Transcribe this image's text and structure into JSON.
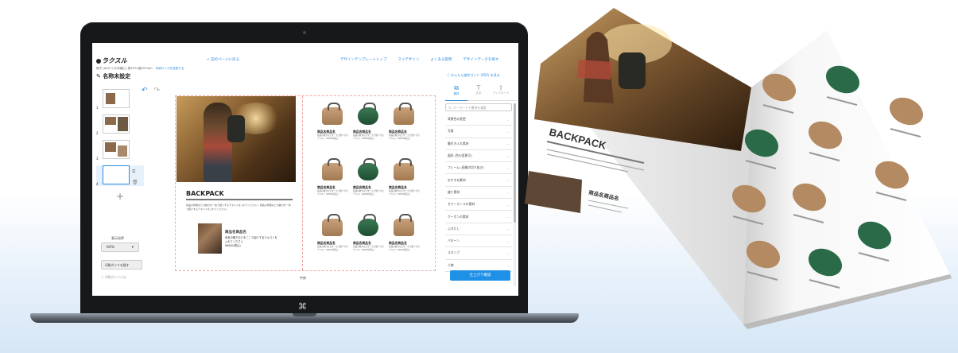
{
  "editor": {
    "logo": "ラクスル",
    "nav_back": "< 前のページに戻る",
    "nav_links": [
      "デザインテンプレートトップ",
      "マイデザイン",
      "よくある質問",
      "デザインデータを探す"
    ],
    "product_info": "冊子 (A4サイズ/中綴じ) 表207×縦297mm",
    "product_info_link": "印刷サイズを変更する",
    "doc_title": "名称未設定",
    "guide_link": "かんたん操作ガイド (PDF) を見る",
    "page_numbers": [
      "1",
      "2",
      "3",
      "4"
    ],
    "add_page": "+",
    "zoom_label": "表示倍率",
    "zoom_value": "60%",
    "guide_button": "印刷ガイドを隠す",
    "help_link": "印刷ガイドとは",
    "page_center_label": "中央"
  },
  "spread": {
    "title": "BACKPACK",
    "description": "商品の特徴などの魅力を一言で紹介するテキストを入れてください。商品の特徴などの魅力を一言で紹介するテキストを入れてください。",
    "lower_product_name": "商品名商品名",
    "lower_product_desc": [
      "商品の魅力などをここで紹介するテキストを",
      "入れてください",
      "¥0000(税込)"
    ],
    "products": [
      {
        "name": "商品名商品名",
        "desc": "商品の魅力などを一言で紹介するテキスト ¥0000(税込)",
        "color": "tan"
      },
      {
        "name": "商品名商品名",
        "desc": "商品の魅力などを一言で紹介するテキスト ¥0000(税込)",
        "color": "green"
      },
      {
        "name": "商品名商品名",
        "desc": "商品の魅力などを一言で紹介するテキスト ¥0000(税込)",
        "color": "tan"
      },
      {
        "name": "商品名商品名",
        "desc": "商品の魅力などを一言で紹介するテキスト ¥0000(税込)",
        "color": "tan"
      },
      {
        "name": "商品名商品名",
        "desc": "商品の魅力などを一言で紹介するテキスト ¥0000(税込)",
        "color": "green"
      },
      {
        "name": "商品名商品名",
        "desc": "商品の魅力などを一言で紹介するテキスト ¥0000(税込)",
        "color": "tan"
      },
      {
        "name": "商品名商品名",
        "desc": "商品の魅力などを一言で紹介するテキスト ¥0000(税込)",
        "color": "tan"
      },
      {
        "name": "商品名商品名",
        "desc": "商品の魅力などを一言で紹介するテキスト ¥0000(税込)",
        "color": "green"
      },
      {
        "name": "商品名商品名",
        "desc": "商品の魅力などを一言で紹介するテキスト ¥0000(税込)",
        "color": "tan"
      }
    ]
  },
  "panel": {
    "tabs": [
      {
        "label": "素材",
        "icon": "shapes-icon"
      },
      {
        "label": "文字",
        "icon": "text-icon"
      },
      {
        "label": "アップロード",
        "icon": "upload-icon"
      }
    ],
    "search_placeholder": "キーワードで素材を検索",
    "categories": [
      "背景色の変更",
      "写真",
      "墨付き入れ素材",
      "図形 (色の変更可)",
      "フレーム (画像の切り抜き)",
      "おすすめ素材",
      "盛り素材",
      "セマーカールの素材",
      "クーポンの素材",
      "ふきだし",
      "パターン",
      "スタンプ",
      "人物"
    ],
    "finish_button": "仕上がり確認"
  },
  "catalog": {
    "title": "BACKPACK",
    "product_name": "商品名商品名"
  },
  "colors": {
    "accent": "#1e90e6",
    "link": "#2b8be0",
    "bag_tan": "#b38a62",
    "bag_green": "#2a6a48"
  }
}
